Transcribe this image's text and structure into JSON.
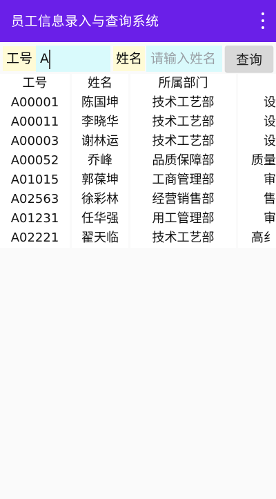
{
  "app": {
    "title": "员工信息录入与查询系统"
  },
  "search": {
    "id_label": "工号",
    "id_value": "A",
    "name_label": "姓名",
    "name_placeholder": "请输入姓名",
    "query_button": "查询"
  },
  "table": {
    "headers": [
      "工号",
      "姓名",
      "所属部门",
      ""
    ],
    "rows": [
      [
        "A00001",
        "陈国坤",
        "技术工艺部",
        "设"
      ],
      [
        "A00011",
        "李晓华",
        "技术工艺部",
        "设"
      ],
      [
        "A00003",
        "谢林运",
        "技术工艺部",
        "设"
      ],
      [
        "A00052",
        "乔峰",
        "品质保障部",
        "质量"
      ],
      [
        "A01015",
        "郭葆坤",
        "工商管理部",
        "审"
      ],
      [
        "A02563",
        "徐彩林",
        "经营销售部",
        "售"
      ],
      [
        "A01231",
        "任华强",
        "用工管理部",
        "审"
      ],
      [
        "A02221",
        "翟天临",
        "技术工艺部",
        "高纟"
      ]
    ]
  }
}
